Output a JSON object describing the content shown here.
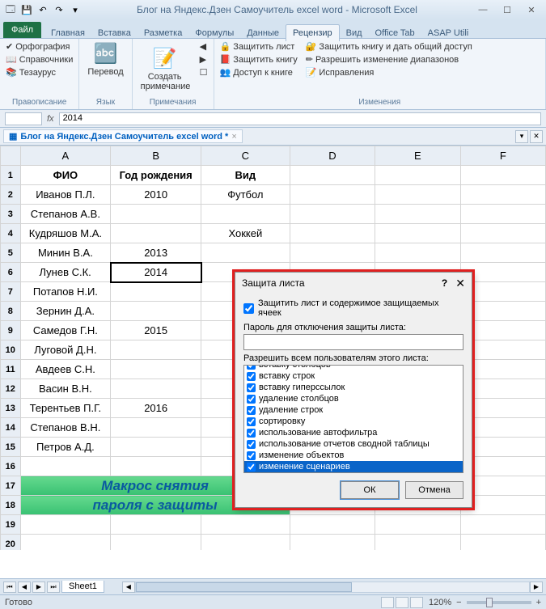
{
  "title": "Блог на Яндекс.Дзен Самоучитель excel word  -  Microsoft Excel",
  "file_tab": "Файл",
  "tabs": [
    "Главная",
    "Вставка",
    "Разметка",
    "Формулы",
    "Данные",
    "Рецензир",
    "Вид",
    "Office Tab",
    "ASAP Utili"
  ],
  "active_tab_index": 5,
  "ribbon": {
    "g1_items": [
      "Орфография",
      "Справочники",
      "Тезаурус"
    ],
    "g1_label": "Правописание",
    "g2_btn": "Перевод",
    "g2_label": "Язык",
    "g3_btn": "Создать примечание",
    "g3_label": "Примечания",
    "g4_items": [
      "Защитить лист",
      "Защитить книгу",
      "Доступ к книге",
      "Защитить книгу и дать общий доступ",
      "Разрешить изменение диапазонов",
      "Исправления"
    ],
    "g4_label": "Изменения"
  },
  "formula_bar": {
    "name": "",
    "value": "2014"
  },
  "doc_tab": "Блог на Яндекс.Дзен Самоучитель excel word *",
  "columns": [
    "A",
    "B",
    "C",
    "D",
    "E",
    "F"
  ],
  "rows": [
    {
      "n": 1,
      "a": "ФИО",
      "b": "Год рождения",
      "c": "Вид",
      "bold": true
    },
    {
      "n": 2,
      "a": "Иванов П.Л.",
      "b": "2010",
      "c": "Футбол"
    },
    {
      "n": 3,
      "a": "Степанов А.В.",
      "b": "",
      "c": ""
    },
    {
      "n": 4,
      "a": "Кудряшов М.А.",
      "b": "",
      "c": "Хоккей"
    },
    {
      "n": 5,
      "a": "Минин В.А.",
      "b": "2013",
      "c": ""
    },
    {
      "n": 6,
      "a": "Лунев С.К.",
      "b": "2014",
      "c": "",
      "sel": true
    },
    {
      "n": 7,
      "a": "Потапов Н.И.",
      "b": "",
      "c": ""
    },
    {
      "n": 8,
      "a": "Зернин Д.А.",
      "b": "",
      "c": ""
    },
    {
      "n": 9,
      "a": "Самедов Г.Н.",
      "b": "2015",
      "c": ""
    },
    {
      "n": 10,
      "a": "Луговой Д.Н.",
      "b": "",
      "c": ""
    },
    {
      "n": 11,
      "a": "Авдеев С.Н.",
      "b": "",
      "c": ""
    },
    {
      "n": 12,
      "a": "Васин В.Н.",
      "b": "",
      "c": ""
    },
    {
      "n": 13,
      "a": "Терентьев П.Г.",
      "b": "2016",
      "c": ""
    },
    {
      "n": 14,
      "a": "Степанов В.Н.",
      "b": "",
      "c": ""
    },
    {
      "n": 15,
      "a": "Петров А.Д.",
      "b": "",
      "c": ""
    },
    {
      "n": 16,
      "a": "",
      "b": "",
      "c": ""
    }
  ],
  "banner1": "Макрос снятия",
  "banner2": "пароля с защиты",
  "extra_rows": [
    19,
    20
  ],
  "sheet": "Sheet1",
  "status": "Готово",
  "zoom": "120%",
  "dialog": {
    "title": "Защита листа",
    "main_check": "Защитить лист и содержимое защищаемых ячеек",
    "pwd_label": "Пароль для отключения защиты листа:",
    "perm_label": "Разрешить всем пользователям этого листа:",
    "perms": [
      "вставку столбцов",
      "вставку строк",
      "вставку гиперссылок",
      "удаление столбцов",
      "удаление строк",
      "сортировку",
      "использование автофильтра",
      "использование отчетов сводной таблицы",
      "изменение объектов",
      "изменение сценариев"
    ],
    "selected_index": 9,
    "ok": "ОК",
    "cancel": "Отмена"
  }
}
